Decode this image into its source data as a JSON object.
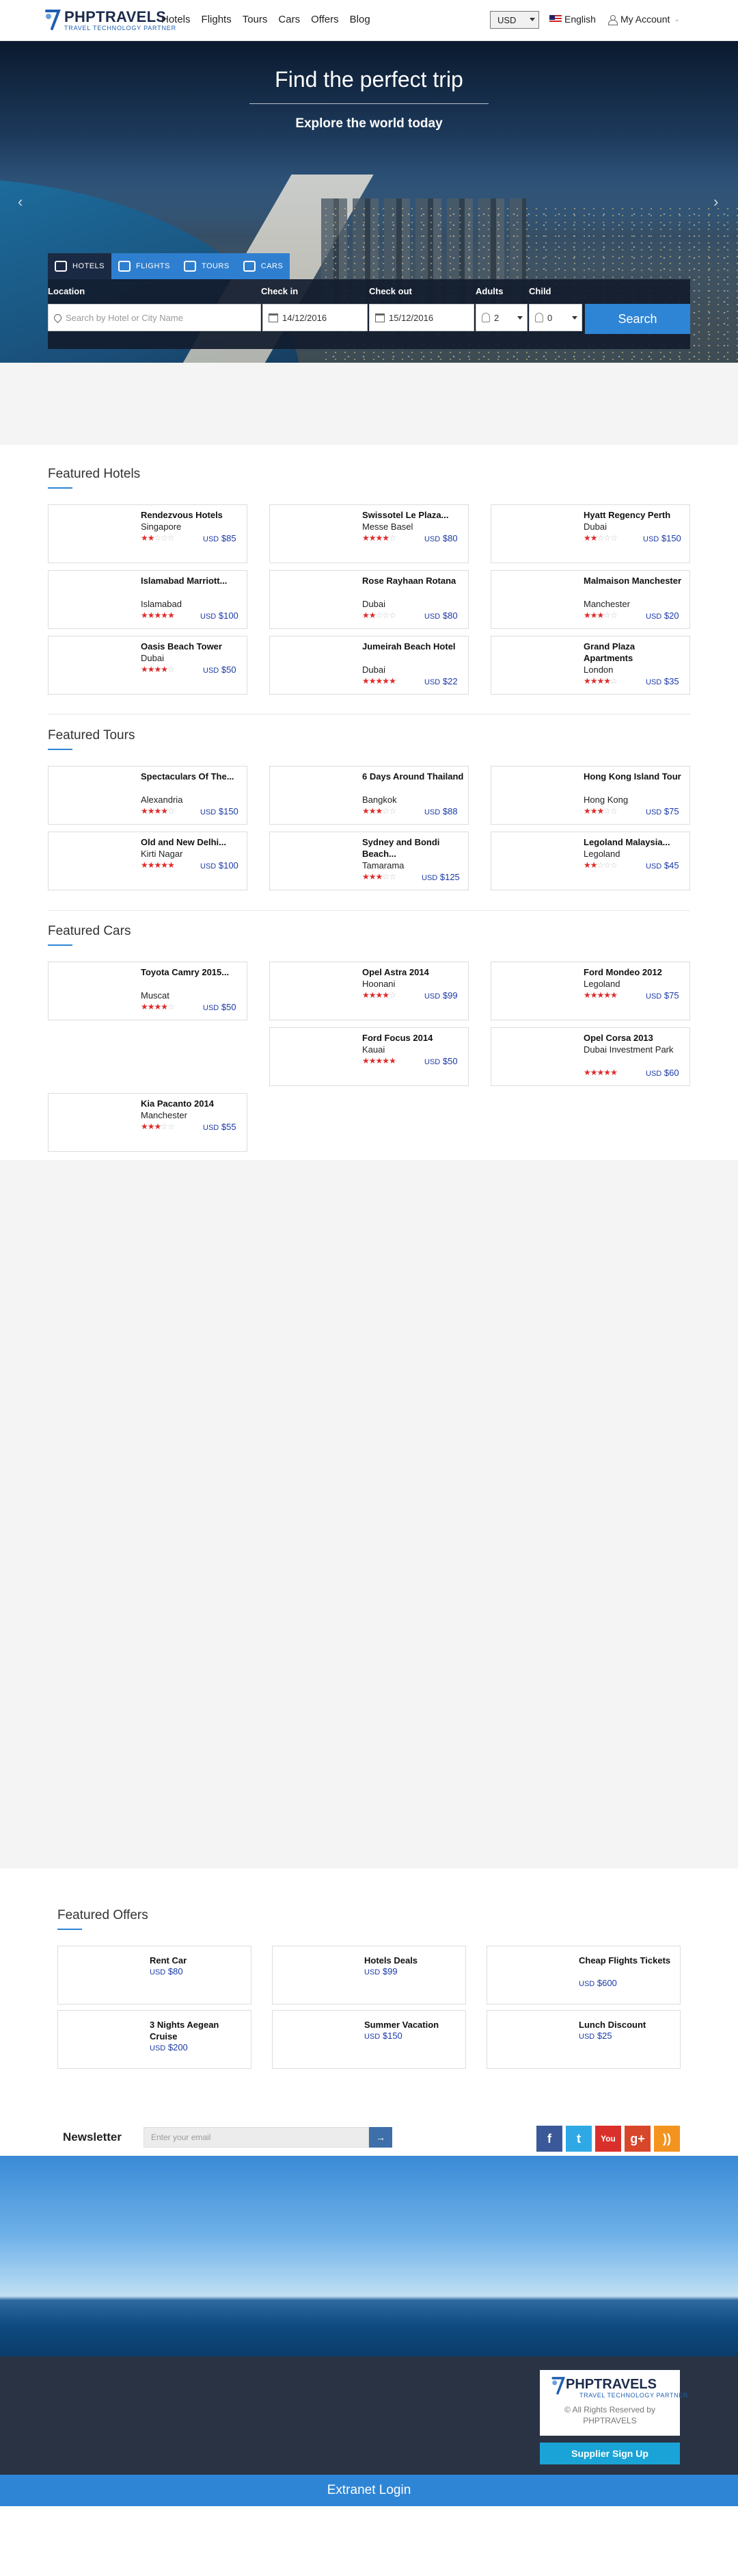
{
  "brand": {
    "name": "PHPTRAVELS",
    "tagline": "TRAVEL TECHNOLOGY PARTNER"
  },
  "nav": [
    "Hotels",
    "Flights",
    "Tours",
    "Cars",
    "Offers",
    "Blog"
  ],
  "header": {
    "currency": "USD",
    "language": "English",
    "account": "My Account"
  },
  "hero": {
    "title": "Find the perfect trip",
    "subtitle": "Explore the world today"
  },
  "tabs": [
    {
      "label": "HOTELS",
      "icon": "hotel-icon"
    },
    {
      "label": "FLIGHTS",
      "icon": "plane-icon"
    },
    {
      "label": "TOURS",
      "icon": "tour-icon"
    },
    {
      "label": "CARS",
      "icon": "car-icon"
    }
  ],
  "search": {
    "location_label": "Location",
    "location_placeholder": "Search by Hotel or City Name",
    "checkin_label": "Check in",
    "checkin_value": "14/12/2016",
    "checkout_label": "Check out",
    "checkout_value": "15/12/2016",
    "adults_label": "Adults",
    "adults_value": "2",
    "child_label": "Child",
    "child_value": "0",
    "button": "Search"
  },
  "featured_hotels": {
    "title": "Featured Hotels",
    "items": [
      {
        "name": "Rendezvous Hotels",
        "location": "Singapore",
        "rating": 2,
        "currency": "USD",
        "price": "$85"
      },
      {
        "name": "Swissotel Le Plaza...",
        "location": "Messe Basel",
        "rating": 4,
        "currency": "USD",
        "price": "$80"
      },
      {
        "name": "Hyatt Regency Perth",
        "location": "Dubai",
        "rating": 2,
        "currency": "USD",
        "price": "$150"
      },
      {
        "name": "Islamabad Marriott...",
        "location": "Islamabad",
        "rating": 5,
        "currency": "USD",
        "price": "$100"
      },
      {
        "name": "Rose Rayhaan Rotana",
        "location": "Dubai",
        "rating": 2,
        "currency": "USD",
        "price": "$80"
      },
      {
        "name": "Malmaison Manchester",
        "location": "Manchester",
        "rating": 3,
        "currency": "USD",
        "price": "$20"
      },
      {
        "name": "Oasis Beach Tower",
        "location": "Dubai",
        "rating": 4,
        "currency": "USD",
        "price": "$50"
      },
      {
        "name": "Jumeirah Beach Hotel",
        "location": "Dubai",
        "rating": 5,
        "currency": "USD",
        "price": "$22"
      },
      {
        "name": "Grand Plaza Apartments",
        "location": "London",
        "rating": 4,
        "currency": "USD",
        "price": "$35"
      }
    ]
  },
  "featured_tours": {
    "title": "Featured Tours",
    "items": [
      {
        "name": "Spectaculars Of The...",
        "location": "Alexandria",
        "rating": 4,
        "currency": "USD",
        "price": "$150"
      },
      {
        "name": "6 Days Around Thailand",
        "location": "Bangkok",
        "rating": 3,
        "currency": "USD",
        "price": "$88"
      },
      {
        "name": "Hong Kong Island Tour",
        "location": "Hong Kong",
        "rating": 3,
        "currency": "USD",
        "price": "$75"
      },
      {
        "name": "Old and New Delhi...",
        "location": "Kirti Nagar",
        "rating": 5,
        "currency": "USD",
        "price": "$100"
      },
      {
        "name": "Sydney and Bondi Beach...",
        "location": "Tamarama",
        "rating": 3,
        "currency": "USD",
        "price": "$125"
      },
      {
        "name": "Legoland Malaysia...",
        "location": "Legoland",
        "rating": 2,
        "currency": "USD",
        "price": "$45"
      }
    ]
  },
  "featured_cars": {
    "title": "Featured Cars",
    "items": [
      {
        "name": "Toyota Camry 2015...",
        "location": "Muscat",
        "rating": 4,
        "currency": "USD",
        "price": "$50"
      },
      {
        "name": "Opel Astra 2014",
        "location": "Hoonani",
        "rating": 4,
        "currency": "USD",
        "price": "$99"
      },
      {
        "name": "Ford Mondeo 2012",
        "location": "Legoland",
        "rating": 5,
        "currency": "USD",
        "price": "$75"
      },
      {
        "name": "Ford Focus 2014",
        "location": "Kauai",
        "rating": 5,
        "currency": "USD",
        "price": "$50"
      },
      {
        "name": "Opel Corsa 2013",
        "location": "Dubai Investment Park",
        "rating": 5,
        "currency": "USD",
        "price": "$60"
      },
      {
        "name": "Kia Pacanto 2014",
        "location": "Manchester",
        "rating": 3,
        "currency": "USD",
        "price": "$55"
      }
    ]
  },
  "featured_offers": {
    "title": "Featured Offers",
    "items": [
      {
        "name": "Rent Car",
        "currency": "USD",
        "price": "$80"
      },
      {
        "name": "Hotels Deals",
        "currency": "USD",
        "price": "$99"
      },
      {
        "name": "Cheap Flights Tickets",
        "currency": "USD",
        "price": "$600"
      },
      {
        "name": "3 Nights Aegean Cruise",
        "currency": "USD",
        "price": "$200"
      },
      {
        "name": "Summer Vacation",
        "currency": "USD",
        "price": "$150"
      },
      {
        "name": "Lunch Discount",
        "currency": "USD",
        "price": "$25"
      }
    ]
  },
  "newsletter": {
    "label": "Newsletter",
    "placeholder": "Enter your email",
    "submit": "→"
  },
  "social": [
    {
      "name": "facebook",
      "glyph": "f",
      "color": "#3b5998"
    },
    {
      "name": "twitter",
      "glyph": "t",
      "color": "#2fa9e6"
    },
    {
      "name": "youtube",
      "glyph": "You",
      "color": "#d9302b"
    },
    {
      "name": "google-plus",
      "glyph": "g+",
      "color": "#d9472b"
    },
    {
      "name": "rss",
      "glyph": "))",
      "color": "#f39420"
    }
  ],
  "footer": {
    "rights": "© All Rights Reserved by PHPTRAVELS",
    "supplier_button": "Supplier Sign Up",
    "extranet": "Extranet Login"
  },
  "colors": {
    "accent": "#2f85d5",
    "price": "#1b3aa6",
    "star": "#e02b2b",
    "footer": "#293343"
  }
}
